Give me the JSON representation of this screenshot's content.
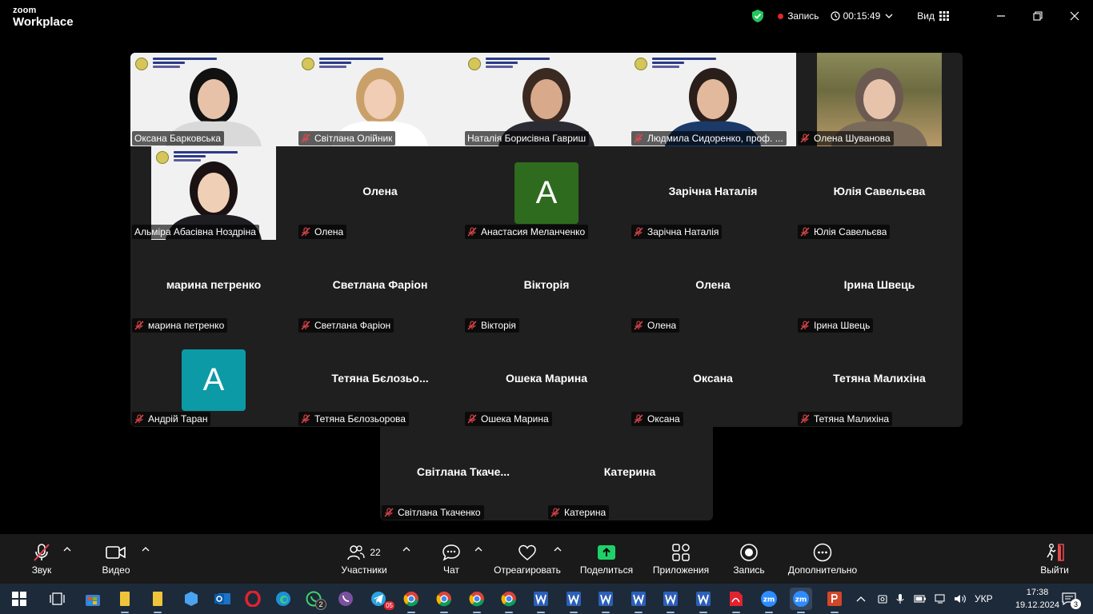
{
  "app": {
    "logo_top": "zoom",
    "logo_bottom": "Workplace"
  },
  "topbar": {
    "recording_label": "Запись",
    "timer": "00:15:49",
    "view_label": "Вид"
  },
  "video_banner": {
    "line1": "Національний фармацевтичний",
    "line2": "університет",
    "tag": "#НФаУ_start"
  },
  "gallery": [
    {
      "name": "Оксана Барковська",
      "muted": false,
      "type": "video",
      "active": true
    },
    {
      "name": "Світлана Олійник",
      "muted": true,
      "type": "video"
    },
    {
      "name": "Наталія Борисівна Гавриш",
      "muted": false,
      "type": "video"
    },
    {
      "name": "Людмила Сидоренко, проф. ...",
      "muted": true,
      "type": "video"
    },
    {
      "name": "Олена Шуванова",
      "muted": true,
      "type": "video"
    },
    {
      "name": "Альміра Абасівна Ноздріна",
      "muted": false,
      "type": "video"
    },
    {
      "name": "Олена",
      "display": "Олена",
      "muted": true,
      "type": "name"
    },
    {
      "name": "Анастасия Меланченко",
      "muted": true,
      "type": "avatar",
      "avatar_letter": "A",
      "avatar_color": "#2f6b1f"
    },
    {
      "name": "Зарічна Наталія",
      "display": "Зарічна Наталія",
      "muted": true,
      "type": "name"
    },
    {
      "name": "Юлія Савельєва",
      "display": "Юлія Савельєва",
      "muted": true,
      "type": "name"
    },
    {
      "name": "марина петренко",
      "display": "марина петренко",
      "muted": true,
      "type": "name"
    },
    {
      "name": "Светлана Фаріон",
      "display": "Светлана Фаріон",
      "muted": true,
      "type": "name"
    },
    {
      "name": "Вікторія",
      "display": "Вікторія",
      "muted": true,
      "type": "name"
    },
    {
      "name": "Олена",
      "display": "Олена",
      "muted": true,
      "type": "name"
    },
    {
      "name": "Ірина Швець",
      "display": "Ірина Швець",
      "muted": true,
      "type": "name"
    },
    {
      "name": "Андрій Таран",
      "muted": true,
      "type": "avatar",
      "avatar_letter": "A",
      "avatar_color": "#0b9aa6"
    },
    {
      "name": "Тетяна Бєлозьорова",
      "display": "Тетяна Бєлозьо...",
      "muted": true,
      "type": "name"
    },
    {
      "name": "Ошека Марина",
      "display": "Ошека Марина",
      "muted": true,
      "type": "name"
    },
    {
      "name": "Оксана",
      "display": "Оксана",
      "muted": true,
      "type": "name"
    },
    {
      "name": "Тетяна Малихіна",
      "display": "Тетяна Малихіна",
      "muted": true,
      "type": "name"
    },
    {
      "name": "Світлана Ткаченко",
      "display": "Світлана  Ткаче...",
      "muted": true,
      "type": "name"
    },
    {
      "name": "Катерина",
      "display": "Катерина",
      "muted": true,
      "type": "name"
    }
  ],
  "toolbar": {
    "audio": "Звук",
    "video": "Видео",
    "participants": "Участники",
    "participants_count": "22",
    "chat": "Чат",
    "react": "Отреагировать",
    "share": "Поделиться",
    "apps": "Приложения",
    "record": "Запись",
    "more": "Дополнительно",
    "leave": "Выйти"
  },
  "taskbar": {
    "language": "УКР",
    "time": "17:38",
    "date": "19.12.2024",
    "notifications": "3",
    "whatsapp_badge": "2",
    "telegram_badge": "05"
  },
  "colors": {
    "active_speaker": "#2bd67b",
    "recording_dot": "#e02828",
    "share_green": "#1fd168",
    "muted_red": "#e5484d"
  }
}
